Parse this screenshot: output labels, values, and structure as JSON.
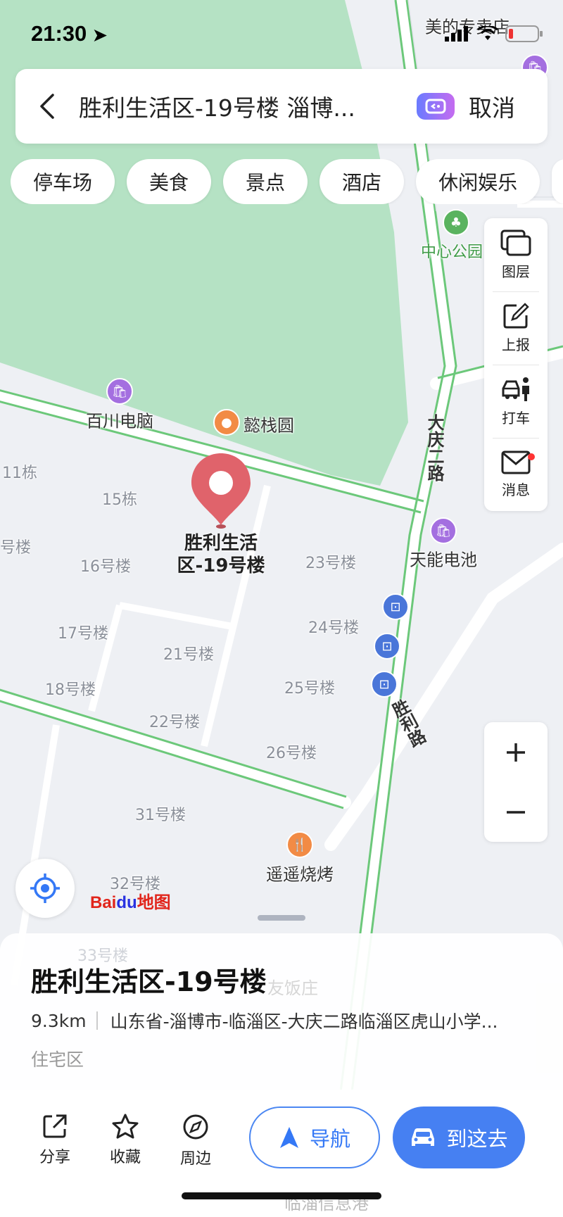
{
  "status_bar": {
    "time": "21:30"
  },
  "search": {
    "query": "胜利生活区-19号楼 淄博...",
    "cancel_label": "取消"
  },
  "chips": [
    "停车场",
    "美食",
    "景点",
    "酒店",
    "休闲娱乐"
  ],
  "toolbar": {
    "layers": "图层",
    "report": "上报",
    "taxi": "打车",
    "messages": "消息"
  },
  "map": {
    "labels": {
      "top_shop": "美的专卖店",
      "park": "中心公园",
      "baichuan": "百川电脑",
      "yizhanyuan": "懿栈圆",
      "b11": "11栋",
      "b15": "15栋",
      "road_daqing": "大庆二路",
      "tianneng": "天能电池",
      "b_left": "号楼",
      "b16": "16号楼",
      "b23": "23号楼",
      "b24": "24号楼",
      "b17": "17号楼",
      "b21": "21号楼",
      "b25": "25号楼",
      "b18": "18号楼",
      "b22": "22号楼",
      "road_shengli": "胜利路",
      "b26": "26号楼",
      "b31": "31号楼",
      "yaoyao": "遥遥烧烤",
      "b32": "32号楼",
      "b33": "33号楼",
      "hotel_partial": "友饭庄",
      "bottom_partial": "临淄信息港"
    },
    "pin_label": "胜利生活区-19号楼",
    "baidu_logo": "Bai地图"
  },
  "place": {
    "title": "胜利生活区-19号楼",
    "distance": "9.3km",
    "address": "山东省-淄博市-临淄区-大庆二路临淄区虎山小学...",
    "category": "住宅区"
  },
  "actions": {
    "share": "分享",
    "favorite": "收藏",
    "nearby": "周边",
    "navigate": "导航",
    "go_here": "到这去"
  }
}
